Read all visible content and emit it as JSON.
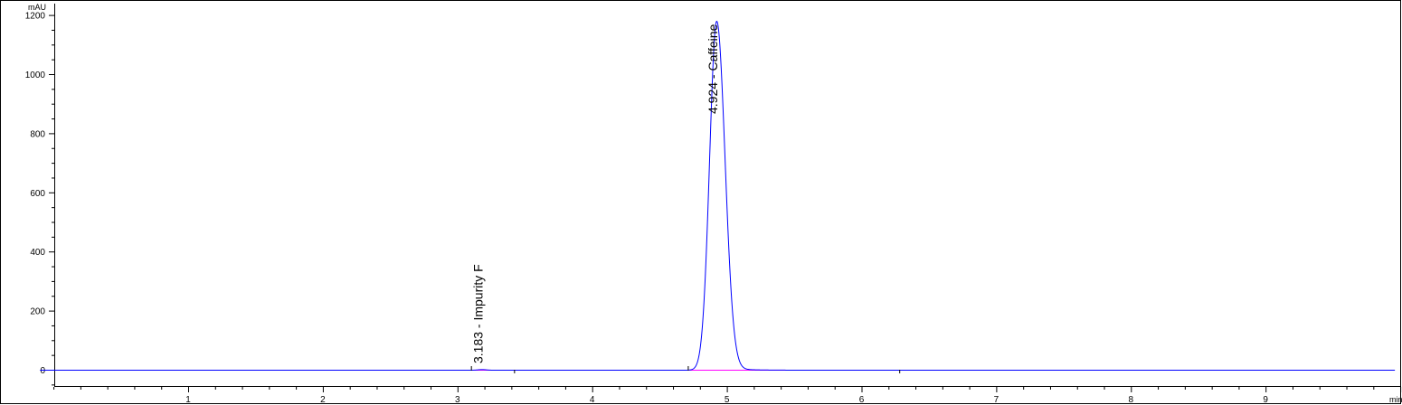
{
  "chart_data": {
    "type": "line",
    "y_unit": "mAU",
    "x_unit": "min",
    "xlim": [
      -0.1,
      10.0
    ],
    "ylim": [
      -60,
      1215
    ],
    "x_ticks": [
      1,
      2,
      3,
      4,
      5,
      6,
      7,
      8,
      9
    ],
    "y_ticks": [
      0,
      200,
      400,
      600,
      800,
      1000,
      1200
    ],
    "x_minor_step": 0.2,
    "y_minor_step": 50,
    "grid": false,
    "legend": "none",
    "peaks": [
      {
        "rt": 3.183,
        "name": "Impurity F",
        "label": "3.183 -  Impurity F",
        "height": 2
      },
      {
        "rt": 4.924,
        "name": "Caffeine",
        "label": "4.924 - Caffeine",
        "height": 1180
      }
    ],
    "integration_segments": [
      {
        "start": 3.1,
        "end": 3.42
      },
      {
        "start": 4.71,
        "end": 6.28
      }
    ],
    "colors": {
      "signal": "#0000ff",
      "baseline": "#ff00ff",
      "axis": "#000000"
    }
  }
}
